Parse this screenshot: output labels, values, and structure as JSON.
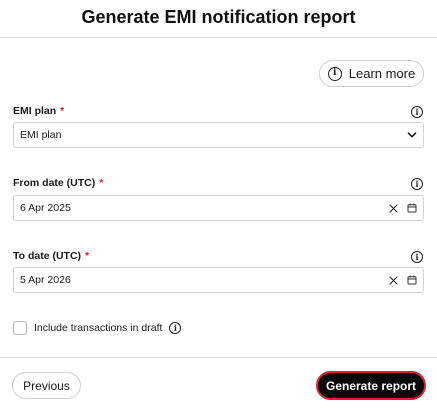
{
  "dialog": {
    "title": "Generate EMI notification report",
    "learn_more_label": "Learn more"
  },
  "form": {
    "emi_plan": {
      "label": "EMI plan",
      "required_mark": "*",
      "value": "EMI plan"
    },
    "from_date": {
      "label": "From date (UTC)",
      "required_mark": "*",
      "value": "6 Apr 2025"
    },
    "to_date": {
      "label": "To date (UTC)",
      "required_mark": "*",
      "value": "5 Apr 2026"
    },
    "include_draft": {
      "label": "Include transactions in draft",
      "checked": false
    }
  },
  "footer": {
    "previous_label": "Previous",
    "generate_label": "Generate report"
  },
  "icons": {
    "info": "info-icon",
    "chevron": "chevron-down-icon",
    "clear": "clear-icon",
    "calendar": "calendar-icon"
  },
  "colors": {
    "required": "#d2202f",
    "primary_button": "#0a0a0a",
    "focus_ring": "#e11d2e"
  }
}
